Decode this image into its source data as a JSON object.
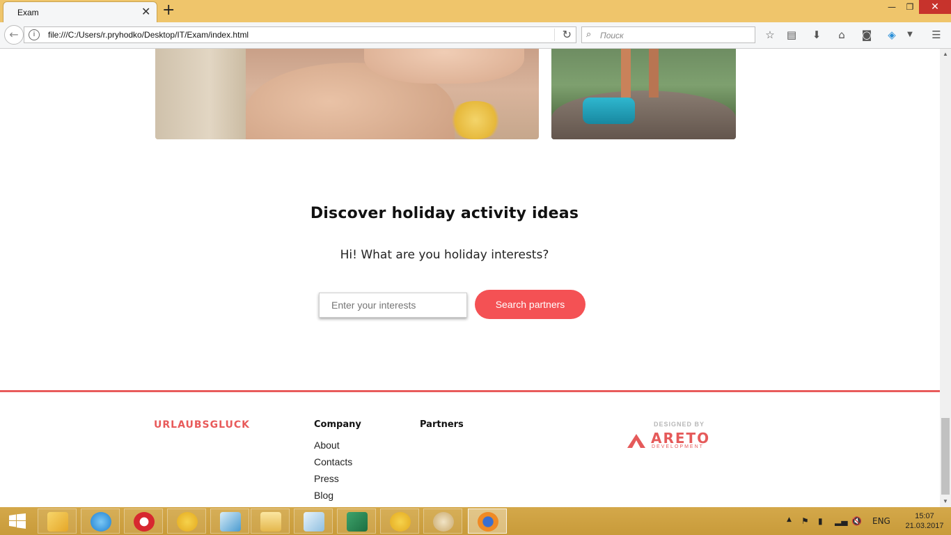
{
  "browser": {
    "tab_title": "Exam",
    "url": "file:///C:/Users/r.pryhodko/Desktop/IT/Exam/index.html",
    "search_placeholder": "Поиск"
  },
  "section": {
    "heading": "Discover holiday activity ideas",
    "subheading": "Hi! What are you holiday interests?",
    "input_placeholder": "Enter your interests",
    "button_label": "Search partners"
  },
  "footer": {
    "brand": "URLAUBSGLUCK",
    "company_heading": "Company",
    "company_links": [
      "About",
      "Contacts",
      "Press",
      "Blog"
    ],
    "partners_heading": "Partners",
    "designed_by": "DESIGNED BY",
    "designer_name": "ARETO",
    "designer_sub": "DEVELOPMENT"
  },
  "taskbar": {
    "language": "ENG",
    "time": "15:07",
    "date": "21.03.2017",
    "apps": [
      "outlook-icon",
      "internet-explorer-icon",
      "opera-icon",
      "1c-icon",
      "lync-icon",
      "file-explorer-icon",
      "notepad-icon",
      "excel-icon",
      "1c-icon",
      "paint-icon",
      "firefox-icon"
    ]
  },
  "colors": {
    "accent": "#f45154",
    "brand": "#e85a5a",
    "tabbar": "#efc56b",
    "taskbar": "#c89b3a"
  }
}
